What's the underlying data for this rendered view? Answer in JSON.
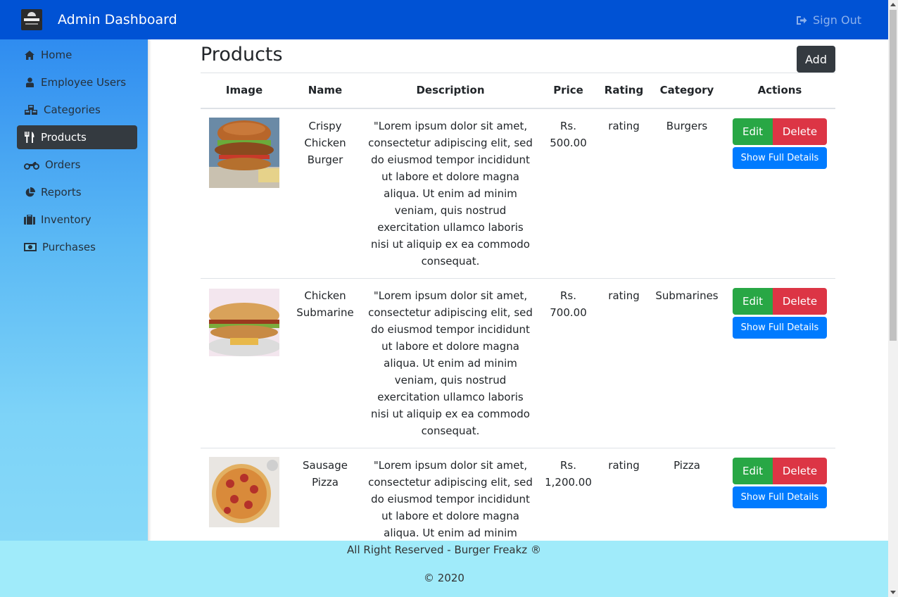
{
  "header": {
    "title": "Admin Dashboard",
    "sign_out": "Sign Out",
    "logo_icon": "burger-freakz-logo"
  },
  "sidebar": {
    "items": [
      {
        "label": "Home",
        "icon": "home-icon"
      },
      {
        "label": "Employee Users",
        "icon": "user-icon"
      },
      {
        "label": "Categories",
        "icon": "cubes-icon"
      },
      {
        "label": "Products",
        "icon": "cutlery-icon",
        "active": true
      },
      {
        "label": "Orders",
        "icon": "motorcycle-icon"
      },
      {
        "label": "Reports",
        "icon": "pie-chart-icon"
      },
      {
        "label": "Inventory",
        "icon": "briefcase-icon"
      },
      {
        "label": "Purchases",
        "icon": "money-icon"
      }
    ]
  },
  "main": {
    "title": "Products",
    "add_label": "Add",
    "columns": [
      "Image",
      "Name",
      "Description",
      "Price",
      "Rating",
      "Category",
      "Actions"
    ],
    "rows": [
      {
        "image": "crispy-chicken-burger-photo",
        "name": "Crispy Chicken Burger",
        "description": "\"Lorem ipsum dolor sit amet, consectetur adipiscing elit, sed do eiusmod tempor incididunt ut labore et dolore magna aliqua. Ut enim ad minim veniam, quis nostrud exercitation ullamco laboris nisi ut aliquip ex ea commodo consequat.",
        "price": "Rs. 500.00",
        "rating": "rating",
        "category": "Burgers"
      },
      {
        "image": "chicken-submarine-photo",
        "name": "Chicken Submarine",
        "description": "\"Lorem ipsum dolor sit amet, consectetur adipiscing elit, sed do eiusmod tempor incididunt ut labore et dolore magna aliqua. Ut enim ad minim veniam, quis nostrud exercitation ullamco laboris nisi ut aliquip ex ea commodo consequat.",
        "price": "Rs. 700.00",
        "rating": "rating",
        "category": "Submarines"
      },
      {
        "image": "sausage-pizza-photo",
        "name": "Sausage Pizza",
        "description": "\"Lorem ipsum dolor sit amet, consectetur adipiscing elit, sed do eiusmod tempor incididunt ut labore et dolore magna aliqua. Ut enim ad minim veniam, quis nostrud exercitation ullamco laboris nisi ut aliquip ex ea commodo consequat.",
        "price": "Rs. 1,200.00",
        "rating": "rating",
        "category": "Pizza"
      }
    ],
    "actions": {
      "edit": "Edit",
      "delete": "Delete",
      "details": "Show Full Details"
    }
  },
  "footer": {
    "line1": "All Right Reserved - Burger Freakz ®",
    "line2": "© 2020"
  },
  "colors": {
    "navbar": "#0052d4",
    "active_nav": "#343a40",
    "edit": "#28a745",
    "delete": "#dc3545",
    "details": "#007bff",
    "footer": "#a0ebfa"
  }
}
